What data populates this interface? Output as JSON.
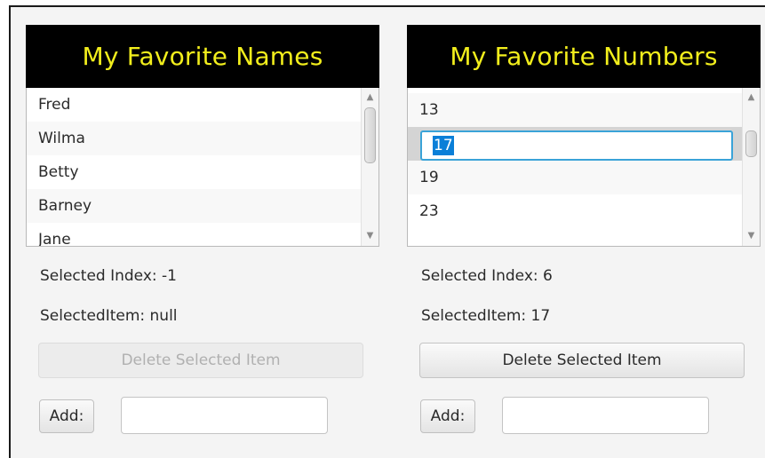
{
  "names_panel": {
    "title": "My Favorite Names",
    "items": [
      "Fred",
      "Wilma",
      "Betty",
      "Barney",
      "Jane"
    ],
    "selected_index_text": "Selected Index: -1",
    "selected_item_text": "SelectedItem: null",
    "delete_label": "Delete Selected Item",
    "add_label": "Add:",
    "add_value": ""
  },
  "numbers_panel": {
    "title": "My Favorite Numbers",
    "items": [
      "13",
      "17",
      "19",
      "23"
    ],
    "editing_value": "17",
    "selected_index_text": "Selected Index: 6",
    "selected_item_text": "SelectedItem: 17",
    "delete_label": "Delete Selected Item",
    "add_label": "Add:",
    "add_value": ""
  },
  "icons": {
    "scroll_up": "chevron-up-icon",
    "scroll_down": "chevron-down-icon"
  },
  "colors": {
    "title_background": "#000000",
    "title_text": "#f2ee1c",
    "edit_focus": "#3aa3d8",
    "text_selection": "#0a7fd8"
  }
}
